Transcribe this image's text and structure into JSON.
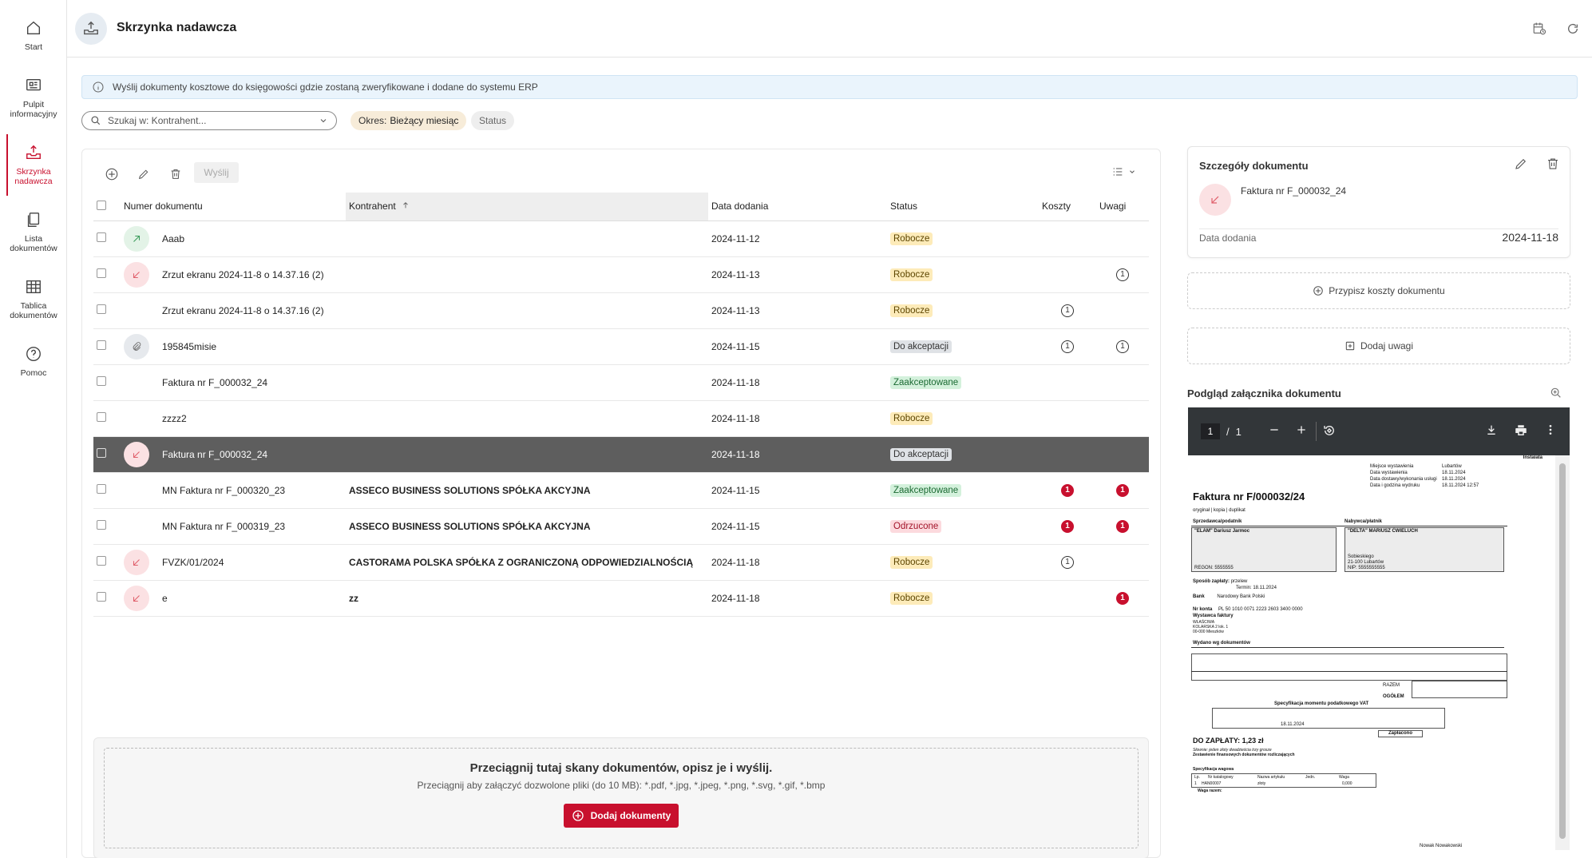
{
  "colors": {
    "accent": "#c8102e",
    "selected_row": "#5e5e5e",
    "info_bg": "#eaf4fc"
  },
  "sidebar": {
    "items": [
      {
        "label_lines": [
          "Start"
        ],
        "icon": "home-icon"
      },
      {
        "label_lines": [
          "Pulpit",
          "informacyjny"
        ],
        "icon": "dashboard-icon"
      },
      {
        "label_lines": [
          "Skrzynka",
          "nadawcza"
        ],
        "icon": "outbox-icon",
        "active": true
      },
      {
        "label_lines": [
          "Lista",
          "dokumentów"
        ],
        "icon": "documents-icon"
      },
      {
        "label_lines": [
          "Tablica",
          "dokumentów"
        ],
        "icon": "table-icon"
      },
      {
        "label_lines": [
          "Pomoc"
        ],
        "icon": "help-icon"
      }
    ]
  },
  "header": {
    "title": "Skrzynka nadawcza"
  },
  "info": {
    "text": "Wyślij dokumenty kosztowe do księgowości gdzie zostaną zweryfikowane i dodane do systemu ERP"
  },
  "filters": {
    "search_placeholder": "Szukaj w: Kontrahent...",
    "period_label": "Okres:",
    "period_value": "Bieżący miesiąc",
    "status_label": "Status"
  },
  "toolbar": {
    "send_label": "Wyślij"
  },
  "table": {
    "columns": [
      "Numer dokumentu",
      "Kontrahent",
      "Data dodania",
      "Status",
      "Koszty",
      "Uwagi"
    ],
    "rows": [
      {
        "icon": "green",
        "number": "Aaab",
        "kontrahent": "",
        "date": "2024-11-12",
        "status": "Robocze",
        "koszty": "",
        "uwagi": ""
      },
      {
        "icon": "red",
        "number": "Zrzut ekranu 2024-11-8 o 14.37.16 (2)",
        "kontrahent": "",
        "date": "2024-11-13",
        "status": "Robocze",
        "koszty": "",
        "uwagi": "outline"
      },
      {
        "icon": "none",
        "number": "Zrzut ekranu 2024-11-8 o 14.37.16 (2)",
        "kontrahent": "",
        "date": "2024-11-13",
        "status": "Robocze",
        "koszty": "outline",
        "uwagi": ""
      },
      {
        "icon": "gray",
        "number": "195845misie",
        "kontrahent": "",
        "date": "2024-11-15",
        "status": "Do akceptacji",
        "koszty": "outline",
        "uwagi": "outline"
      },
      {
        "icon": "none",
        "number": "Faktura nr F_000032_24",
        "kontrahent": "",
        "date": "2024-11-18",
        "status": "Zaakceptowane",
        "koszty": "",
        "uwagi": ""
      },
      {
        "icon": "none",
        "number": "zzzz2",
        "kontrahent": "",
        "date": "2024-11-18",
        "status": "Robocze",
        "koszty": "",
        "uwagi": ""
      },
      {
        "icon": "red",
        "number": "Faktura nr F_000032_24",
        "kontrahent": "",
        "date": "2024-11-18",
        "status": "Do akceptacji",
        "koszty": "",
        "uwagi": "",
        "selected": true
      },
      {
        "icon": "none",
        "number": "MN Faktura nr F_000320_23",
        "kontrahent": "ASSECO BUSINESS SOLUTIONS SPÓŁKA AKCYJNA",
        "date": "2024-11-15",
        "status": "Zaakceptowane",
        "koszty": "red",
        "uwagi": "red"
      },
      {
        "icon": "none",
        "number": "MN Faktura nr F_000319_23",
        "kontrahent": "ASSECO BUSINESS SOLUTIONS SPÓŁKA AKCYJNA",
        "date": "2024-11-15",
        "status": "Odrzucone",
        "koszty": "red",
        "uwagi": "red"
      },
      {
        "icon": "red",
        "number": "FVZK/01/2024",
        "kontrahent": "CASTORAMA POLSKA SPÓŁKA Z OGRANICZONĄ ODPOWIEDZIALNOŚCIĄ",
        "date": "2024-11-18",
        "status": "Robocze",
        "koszty": "outline",
        "uwagi": ""
      },
      {
        "icon": "red",
        "number": "e",
        "kontrahent": "zz",
        "date": "2024-11-18",
        "status": "Robocze",
        "koszty": "",
        "uwagi": "red"
      }
    ],
    "badge_number": "1"
  },
  "dropzone": {
    "title": "Przeciągnij tutaj skany dokumentów, opisz je i wyślij.",
    "subtitle": "Przeciągnij aby załączyć dozwolone pliki (do 10 MB): *.pdf, *.jpg, *.jpeg, *.png, *.svg, *.gif, *.bmp",
    "button": "Dodaj dokumenty"
  },
  "details": {
    "title": "Szczegóły dokumentu",
    "doc_name": "Faktura nr F_000032_24",
    "date_label": "Data dodania",
    "date_value": "2024-11-18",
    "assign_costs": "Przypisz koszty dokumentu",
    "add_notes": "Dodaj uwagi",
    "preview_title": "Podgląd załącznika dokumentu"
  },
  "pdf": {
    "page_current": "1",
    "page_sep": "/",
    "page_total": "1",
    "invoice_title": "Faktura nr F/000032/24",
    "copy_line": "oryginał | kopia | duplikat",
    "meta_labels": [
      "Miejsce wystawienia",
      "Data wystawienia",
      "Data dostawy/wykonania usługi",
      "Data i godzina wydruku"
    ],
    "meta_values": [
      "Lubartów",
      "18.11.2024",
      "18.11.2024",
      "18.11.2024 12:57"
    ],
    "corner": "Instalata",
    "seller_label": "Sprzedawca/podatnik",
    "buyer_label": "Nabywca/płatnik",
    "seller_name": "\"ELAM\" Dariusz Jarmoc",
    "seller_regon": "REGON: 5555555",
    "buyer_name": "\"DELTA\" MARIUSZ ĆWIELUCH",
    "buyer_addr1": "Sobieskiego",
    "buyer_addr2": "21-100 Lubartów",
    "buyer_nip": "NIP: 5555555555",
    "payment_label": "Sposób zapłaty:",
    "payment_value": "przelew",
    "term": "Termin: 18.11.2024",
    "bank_label": "Bank",
    "bank_value": "Narodowy Bank Polski",
    "account_label": "Nr konta",
    "account_value": "PL 50 1010 0071 2223 2603 3400 0000",
    "issuer_label": "Wystawca faktury",
    "issuer_lines": [
      "WŁAŚCIWA",
      "KOLARSKA 2 lok. 1",
      "00-000 Mieszków"
    ],
    "issued_label": "Wydano wg dokumentów",
    "razem": "RAZEM",
    "ogolem": "OGÓŁEM",
    "vat_spec": "Specyfikacja momentu podatkowego VAT",
    "vat_date": "18.11.2024",
    "zaplacono": "Zapłacono",
    "do_zaplaty": "DO ZAPŁATY: 1,23 zł",
    "slownie": "Słownie: jeden złoty dwadzieścia trzy grosze",
    "zestawienie": "Zestawienie finansowych dokumentów rozliczających",
    "spec_wagowa": "Specyfikacja wagowa",
    "spec_headers": [
      "Lp.",
      "Nr katalogowy",
      "Nazwa artykułu",
      "Jedn.",
      "Waga"
    ],
    "spec_row": [
      "1",
      "HAN00007",
      "złoty",
      "",
      "0,000"
    ],
    "waga_razem": "Waga razem:",
    "footer_name": "Nowak Nowakowski"
  }
}
